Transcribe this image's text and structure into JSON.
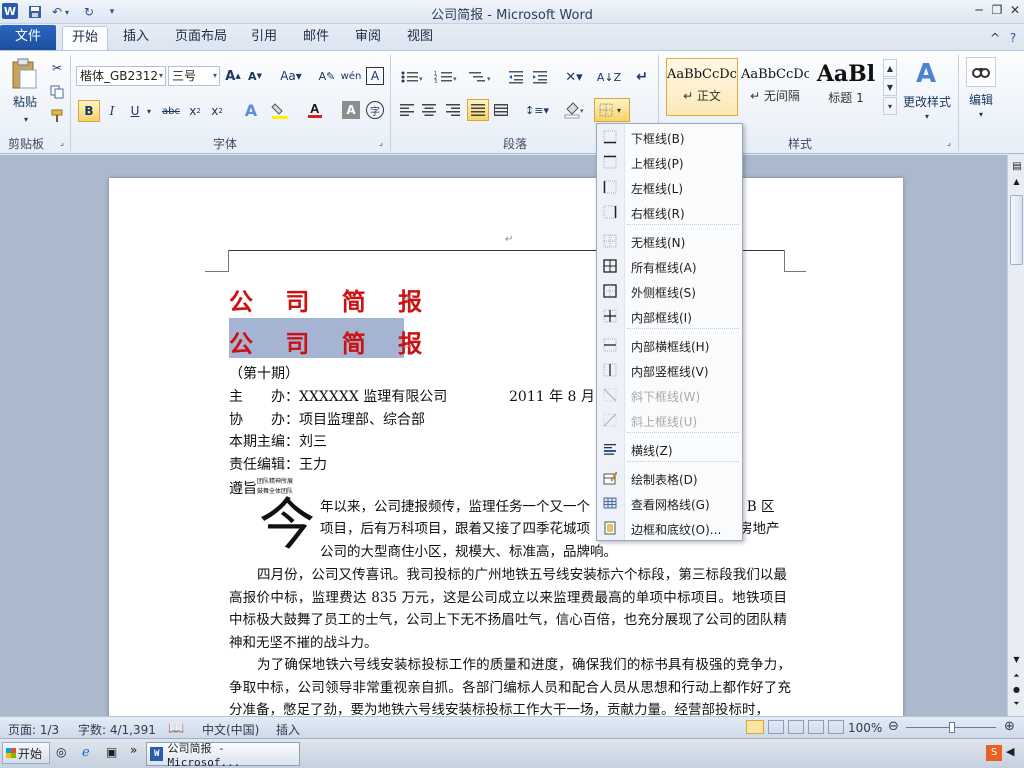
{
  "window": {
    "title": "公司简报 - Microsoft Word"
  },
  "tabs": [
    {
      "label": "文件"
    },
    {
      "label": "开始"
    },
    {
      "label": "插入"
    },
    {
      "label": "页面布局"
    },
    {
      "label": "引用"
    },
    {
      "label": "邮件"
    },
    {
      "label": "审阅"
    },
    {
      "label": "视图"
    }
  ],
  "ribbon": {
    "clipboard": {
      "paste_label": "粘贴",
      "group_label": "剪贴板"
    },
    "font": {
      "font_name": "楷体_GB2312",
      "font_size": "三号",
      "group_label": "字体"
    },
    "paragraph": {
      "group_label": "段落"
    },
    "styles": {
      "group_label": "样式",
      "cards": [
        {
          "sample": "AaBbCcDc",
          "name": "↵ 正文"
        },
        {
          "sample": "AaBbCcDc",
          "name": "↵ 无间隔"
        },
        {
          "sample": "AaBl",
          "name": "标题 1"
        }
      ],
      "change_styles_label": "更改样式"
    },
    "editing": {
      "label": "编辑"
    }
  },
  "document": {
    "header_mark": "↵",
    "title_1": "公 司 简 报",
    "title_2": "公 司 简 报",
    "issue": "（第十期）",
    "host_label": "主　　办：",
    "host_value": "XXXXXX 监理有限公司",
    "date": "2011 年 8 月 1",
    "co_label": "协　　办：",
    "co_value": "项目监理部、综合部",
    "chief_label": "本期主编：",
    "chief_value": "刘三",
    "editor_label": "责任编辑：",
    "editor_value": "王力",
    "motto_label": "遵旨",
    "motto_small_1": "团队精神所展",
    "motto_small_2": "鼓舞全体团队",
    "dropcap": "今",
    "p1_line1": "年以来，公司捷报频传，监理任务一个又一个",
    "p1_line1_end": "城 B 区",
    "p1_line2": "项目，后有万科项目，跟着又接了四季花城项",
    "p1_line2_end": "房地产",
    "p1_line3": "公司的大型商住小区，规模大、标准高，品牌响。",
    "p2": "四月份，公司又传喜讯。我司投标的广州地铁五号线安装标六个标段，第三标段我们以最高报价中标，监理费达 835 万元，这是公司成立以来监理费最高的单项中标项目。地铁项目中标极大鼓舞了员工的士气，公司上下无不扬眉吐气，信心百倍，也充分展现了公司的团队精神和无坚不摧的战斗力。",
    "p3": "为了确保地铁六号线安装标投标工作的质量和进度，确保我们的标书具有极强的竞争力，争取中标，公司领导非常重视亲自抓。各部门编标人员和配合人员从思想和行动上都作好了充分准备，憋足了劲，要为地铁六号线安装标投标工作大干一场，贡献力量。经营部投标时，"
  },
  "border_menu": {
    "items": [
      {
        "label": "下框线(B)",
        "icon": "bottom-border-icon",
        "disabled": false
      },
      {
        "label": "上框线(P)",
        "icon": "top-border-icon",
        "disabled": false
      },
      {
        "label": "左框线(L)",
        "icon": "left-border-icon",
        "disabled": false
      },
      {
        "label": "右框线(R)",
        "icon": "right-border-icon",
        "disabled": false
      },
      {
        "label": "无框线(N)",
        "icon": "no-border-icon",
        "disabled": false
      },
      {
        "label": "所有框线(A)",
        "icon": "all-borders-icon",
        "disabled": false
      },
      {
        "label": "外侧框线(S)",
        "icon": "outside-borders-icon",
        "disabled": false
      },
      {
        "label": "内部框线(I)",
        "icon": "inside-borders-icon",
        "disabled": false
      },
      {
        "label": "内部横框线(H)",
        "icon": "inside-horizontal-border-icon",
        "disabled": false
      },
      {
        "label": "内部竖框线(V)",
        "icon": "inside-vertical-border-icon",
        "disabled": false
      },
      {
        "label": "斜下框线(W)",
        "icon": "diagonal-down-border-icon",
        "disabled": true
      },
      {
        "label": "斜上框线(U)",
        "icon": "diagonal-up-border-icon",
        "disabled": true
      },
      {
        "label": "横线(Z)",
        "icon": "horizontal-line-icon",
        "disabled": false
      },
      {
        "label": "绘制表格(D)",
        "icon": "draw-table-icon",
        "disabled": false
      },
      {
        "label": "查看网格线(G)",
        "icon": "view-gridlines-icon",
        "disabled": false
      },
      {
        "label": "边框和底纹(O)...",
        "icon": "borders-shading-icon",
        "disabled": false
      }
    ]
  },
  "status": {
    "page": "页面: 1/3",
    "words": "字数: 4/1,391",
    "language": "中文(中国)",
    "mode": "插入",
    "zoom": "100%"
  },
  "taskbar": {
    "start_label": "开始",
    "window_label": "公司简报 - Microsof..."
  },
  "colors": {
    "title_red": "#cc1111",
    "ribbon_blue": "#1c4fa0",
    "selection": "#a6b4d4"
  }
}
